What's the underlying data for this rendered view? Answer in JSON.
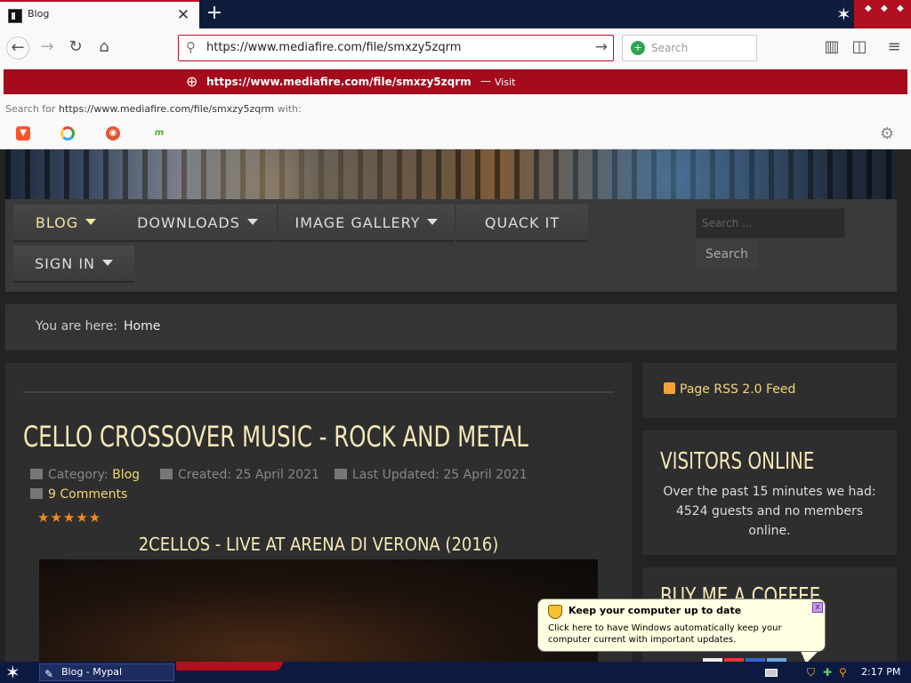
{
  "browser": {
    "tab_title": "Blog",
    "url": "https://www.mediafire.com/file/smxzy5zqrm",
    "search_placeholder": "Search",
    "dropdown": {
      "visit_url": "https://www.mediafire.com/file/smxzy5zqrm",
      "visit_sep": "—",
      "visit_label": "Visit",
      "search_for_prefix": "Search for",
      "search_for_url": "https://www.mediafire.com/file/smxzy5zqrm",
      "search_for_suffix": "with:"
    }
  },
  "site": {
    "menu": [
      {
        "label": "BLOG"
      },
      {
        "label": "DOWNLOADS"
      },
      {
        "label": "IMAGE GALLERY"
      },
      {
        "label": "QUACK IT"
      },
      {
        "label": "SIGN IN"
      }
    ],
    "search_placeholder": "Search ...",
    "search_button": "Search",
    "breadcrumb_prefix": "You are here:",
    "breadcrumb_home": "Home"
  },
  "article": {
    "title": "CELLO CROSSOVER MUSIC - ROCK AND METAL",
    "category_label": "Category:",
    "category": "Blog",
    "created": "Created: 25 April 2021",
    "updated": "Last Updated: 25 April 2021",
    "comments": "9 Comments",
    "rating_stars": "★★★★★",
    "video_title": "2CELLOS - LIVE AT ARENA DI VERONA (2016)"
  },
  "sidebar": {
    "rss": "Page RSS 2.0 Feed",
    "visitors_title": "VISITORS ONLINE",
    "visitors_text": "Over the past 15 minutes we had: 4524 guests and no members online.",
    "coffee_title": "BUY ME A COFFEE"
  },
  "balloon": {
    "title": "Keep your computer up to date",
    "body": "Click here to have Windows automatically keep your computer current with important updates."
  },
  "taskbar": {
    "task_label": "Blog - Mypal",
    "clock": "2:17 PM"
  },
  "colors": {
    "accent_red": "#a40b1c",
    "taskbar": "#0c1a42",
    "heading": "#f6e7b8",
    "link": "#f2d57a"
  }
}
